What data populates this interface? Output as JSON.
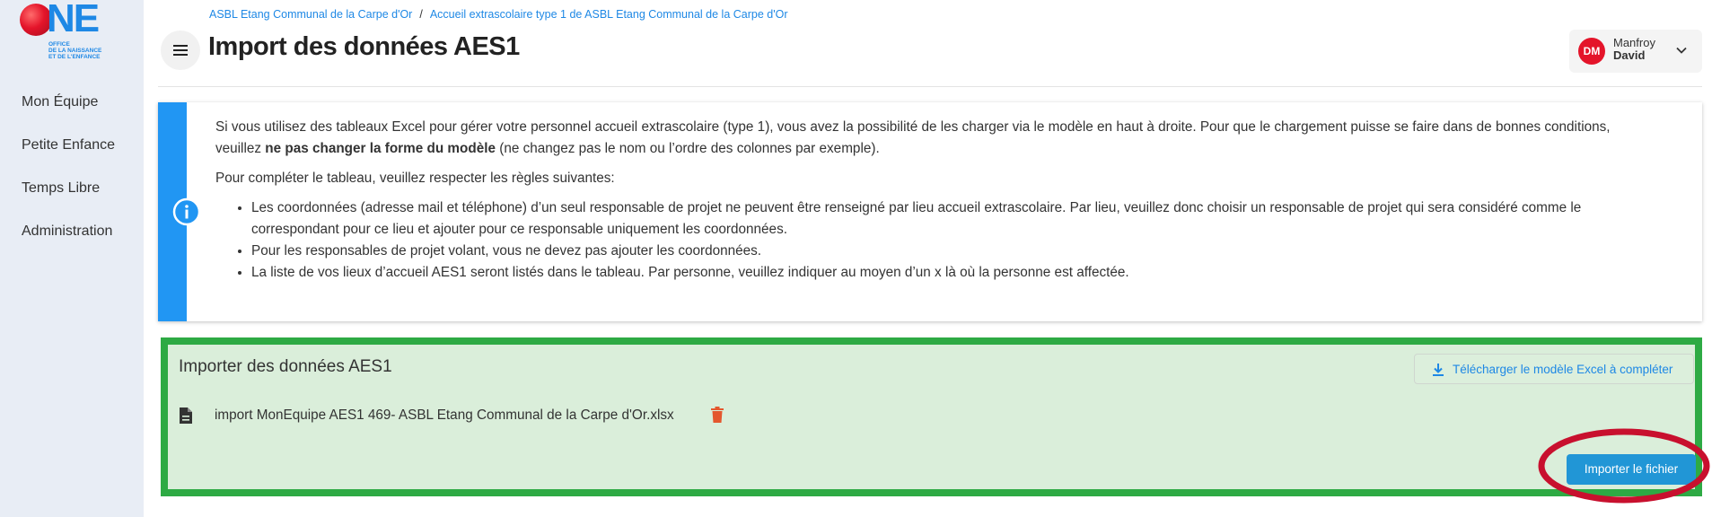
{
  "logo": {
    "text": "ONE",
    "subtitle": "OFFICE\nDE LA NAISSANCE\nET DE L'ENFANCE"
  },
  "sidebar": {
    "items": [
      {
        "label": "Mon Équipe"
      },
      {
        "label": "Petite Enfance"
      },
      {
        "label": "Temps Libre"
      },
      {
        "label": "Administration"
      }
    ]
  },
  "breadcrumb": {
    "items": [
      {
        "label": "ASBL Etang Communal de la Carpe d'Or"
      },
      {
        "label": "Accueil extrascolaire type 1 de ASBL Etang Communal de la Carpe d'Or"
      }
    ],
    "separator": "/"
  },
  "header": {
    "title": "Import des données AES1",
    "menu_icon": "hamburger-menu-icon"
  },
  "user": {
    "initials": "DM",
    "first_name": "Manfroy",
    "last_name": "David"
  },
  "info": {
    "intro_before": "Si vous utilisez des tableaux Excel pour gérer votre personnel accueil extrascolaire (type 1), vous avez la possibilité de les charger via le modèle en haut à droite. Pour que le chargement puisse se faire dans de bonnes conditions, veuillez ",
    "intro_bold": "ne pas changer la forme du modèle",
    "intro_after": " (ne changez pas le nom ou l’ordre des colonnes par exemple).",
    "rules_heading": "Pour compléter le tableau, veuillez respecter les règles suivantes:",
    "rules": [
      "Les coordonnées (adresse mail et téléphone) d’un seul responsable de projet ne peuvent être renseigné par lieu accueil extrascolaire. Par lieu, veuillez donc choisir un responsable de projet qui sera considéré comme le correspondant pour ce lieu et ajouter pour ce responsable uniquement les coordonnées.",
      "Pour les responsables de projet volant, vous ne devez pas ajouter les coordonnées.",
      "La liste de vos lieux d’accueil AES1 seront listés dans le tableau. Par personne, veuillez indiquer au moyen d’un x là où la personne est affectée."
    ],
    "accent_color": "#2196f3"
  },
  "import_section": {
    "title": "Importer des données AES1",
    "download_button": "Télécharger le modèle Excel à compléter",
    "file_name": "import MonEquipe AES1 469- ASBL Etang Communal de la Carpe d'Or.xlsx",
    "import_button": "Importer le fichier",
    "highlight_color": "#2eaa44",
    "annotation_color": "#c8102e"
  }
}
